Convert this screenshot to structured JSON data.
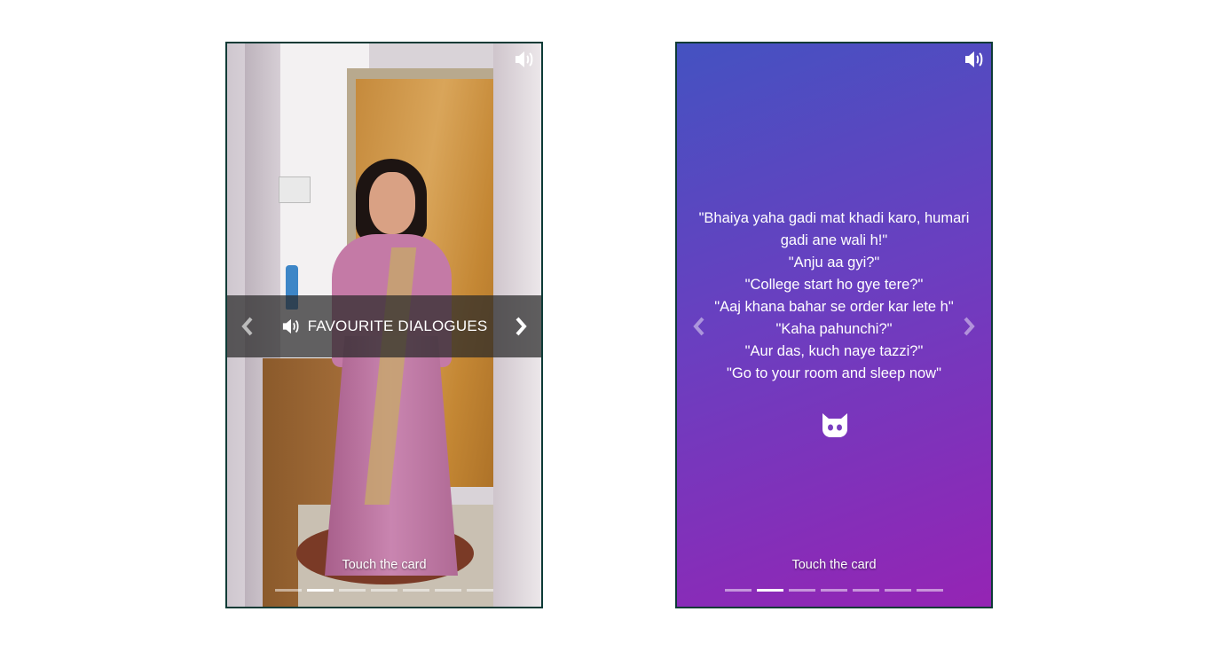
{
  "card_left": {
    "banner_title": "FAVOURITE DIALOGUES",
    "hint": "Touch the card",
    "dots": 7,
    "active_dot": 1
  },
  "card_right": {
    "quotes": [
      "\"Bhaiya yaha gadi mat khadi karo, humari gadi ane wali h!\"",
      "\"Anju aa gyi?\"",
      "\"College start ho gye tere?\"",
      "\"Aaj khana bahar se order kar lete h\"",
      "\"Kaha pahunchi?\"",
      "\"Aur das, kuch naye tazzi?\"",
      "\"Go to your room and sleep now\""
    ],
    "hint": "Touch the card",
    "dots": 7,
    "active_dot": 1
  },
  "icons": {
    "volume": "volume-icon",
    "prev": "chevron-left-icon",
    "next": "chevron-right-icon",
    "mascot": "ghost-icon"
  },
  "colors": {
    "card_border": "#0d3b36",
    "gradient_start": "#4452c1",
    "gradient_end": "#9524b4"
  }
}
